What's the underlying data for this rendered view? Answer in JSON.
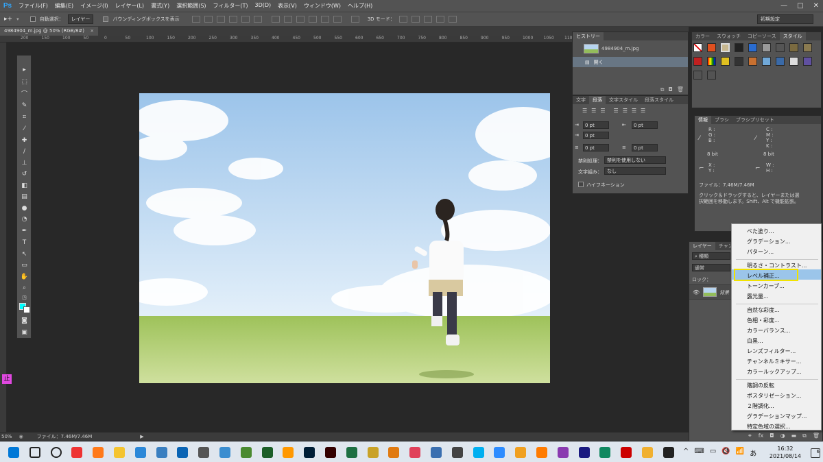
{
  "app": {
    "logo": "Ps"
  },
  "menubar": {
    "items": [
      "ファイル(F)",
      "編集(E)",
      "イメージ(I)",
      "レイヤー(L)",
      "書式(Y)",
      "選択範囲(S)",
      "フィルター(T)",
      "3D(D)",
      "表示(V)",
      "ウィンドウ(W)",
      "ヘルプ(H)"
    ],
    "window_controls": [
      "—",
      "□",
      "✕"
    ]
  },
  "options": {
    "auto_select_label": "自動選択：",
    "auto_select_value": "レイヤー",
    "bbox_label": "バウンディングボックスを表示",
    "mode_3d": "3D モード：",
    "workspace": "初期設定"
  },
  "document": {
    "tab_label": "4984904_m.jpg @ 50% (RGB/8#)",
    "close": "×",
    "ruler_ticks": [
      "200",
      "150",
      "100",
      "50",
      "0",
      "50",
      "100",
      "150",
      "200",
      "250",
      "300",
      "350",
      "400",
      "450",
      "500",
      "550",
      "600",
      "650",
      "700",
      "750",
      "800",
      "850",
      "900",
      "950",
      "1000",
      "1050",
      "1100",
      "1150",
      "1200",
      "1250",
      "1300",
      "1350"
    ]
  },
  "status": {
    "zoom": "50%",
    "file": "ファイル：7.46M/7.46M",
    "arrow": "▶"
  },
  "panels": {
    "history": {
      "tab": "ヒストリー",
      "snapshot": "4984904_m.jpg",
      "step": "開く"
    },
    "paragraph": {
      "tabs": [
        "文字",
        "段落",
        "文字スタイル",
        "段落スタイル"
      ],
      "indent_left": "0 pt",
      "indent_right": "0 pt",
      "indent_first": "0 pt",
      "space_before": "0 pt",
      "space_after": "0 pt",
      "kinsoku_label": "禁則処理：",
      "kinsoku_value": "禁則を使用しない",
      "mojikumi_label": "文字組み：",
      "mojikumi_value": "なし",
      "hyphenation": "ハイフネーション"
    },
    "swatches": {
      "tabs": [
        "カラー",
        "スウォッチ",
        "コピーソース",
        "スタイル"
      ]
    },
    "info": {
      "tabs": [
        "情報",
        "ブラシ",
        "ブラシプリセット"
      ],
      "rgb_labels": [
        "R :",
        "G :",
        "B :"
      ],
      "cmyk_labels": [
        "C :",
        "M :",
        "Y :",
        "K :"
      ],
      "bit_left": "8 bit",
      "bit_right": "8 bit",
      "xy_labels": [
        "X :",
        "Y :"
      ],
      "wh_labels": [
        "W :",
        "H :"
      ],
      "file": "ファイル：7.46M/7.46M",
      "hint": "クリック＆ドラッグすると、レイヤーまたは選択範囲を移動します。Shift、Alt で機能拡張。"
    },
    "layers": {
      "tabs": [
        "レイヤー",
        "チャンネル"
      ],
      "kind": "種類",
      "blend": "通常",
      "lock": "ロック：",
      "layer_name": "背景"
    }
  },
  "context_menu": {
    "groups": [
      [
        "べた塗り...",
        "グラデーション...",
        "パターン..."
      ],
      [
        "明るさ・コントラスト...",
        "レベル補正...",
        "トーンカーブ...",
        "露光量..."
      ],
      [
        "自然な彩度...",
        "色相・彩度...",
        "カラーバランス...",
        "白黒...",
        "レンズフィルター...",
        "チャンネルミキサー...",
        "カラールックアップ..."
      ],
      [
        "階調の反転",
        "ポスタリゼーション...",
        "２階調化...",
        "グラデーションマップ...",
        "特定色域の選択..."
      ]
    ],
    "highlighted": "レベル補正..."
  },
  "marker": {
    "label": "止"
  },
  "taskbar": {
    "time": "16:32",
    "date": "2021/08/14",
    "ime": "あ",
    "notif_count": "6",
    "icons": [
      "windows-logo",
      "search",
      "cortana",
      "chrome",
      "firefox",
      "file-explorer",
      "edge",
      "photos",
      "outlook",
      "settings",
      "news",
      "minecraft",
      "dreamweaver",
      "sublime",
      "photoshop",
      "illustrator",
      "excel",
      "notepad",
      "butterfly",
      "vectorizer",
      "paint",
      "7zip",
      "skype",
      "zoom",
      "media",
      "vlc",
      "krita",
      "musescore",
      "inkscape",
      "obs",
      "gimp",
      "sticky"
    ],
    "tray_ic": [
      "^",
      "⌨",
      "▭",
      "🔇",
      "📶"
    ],
    "colors": {
      "taskbar": "#dfe6ee",
      "accent": "#0078d7"
    }
  }
}
